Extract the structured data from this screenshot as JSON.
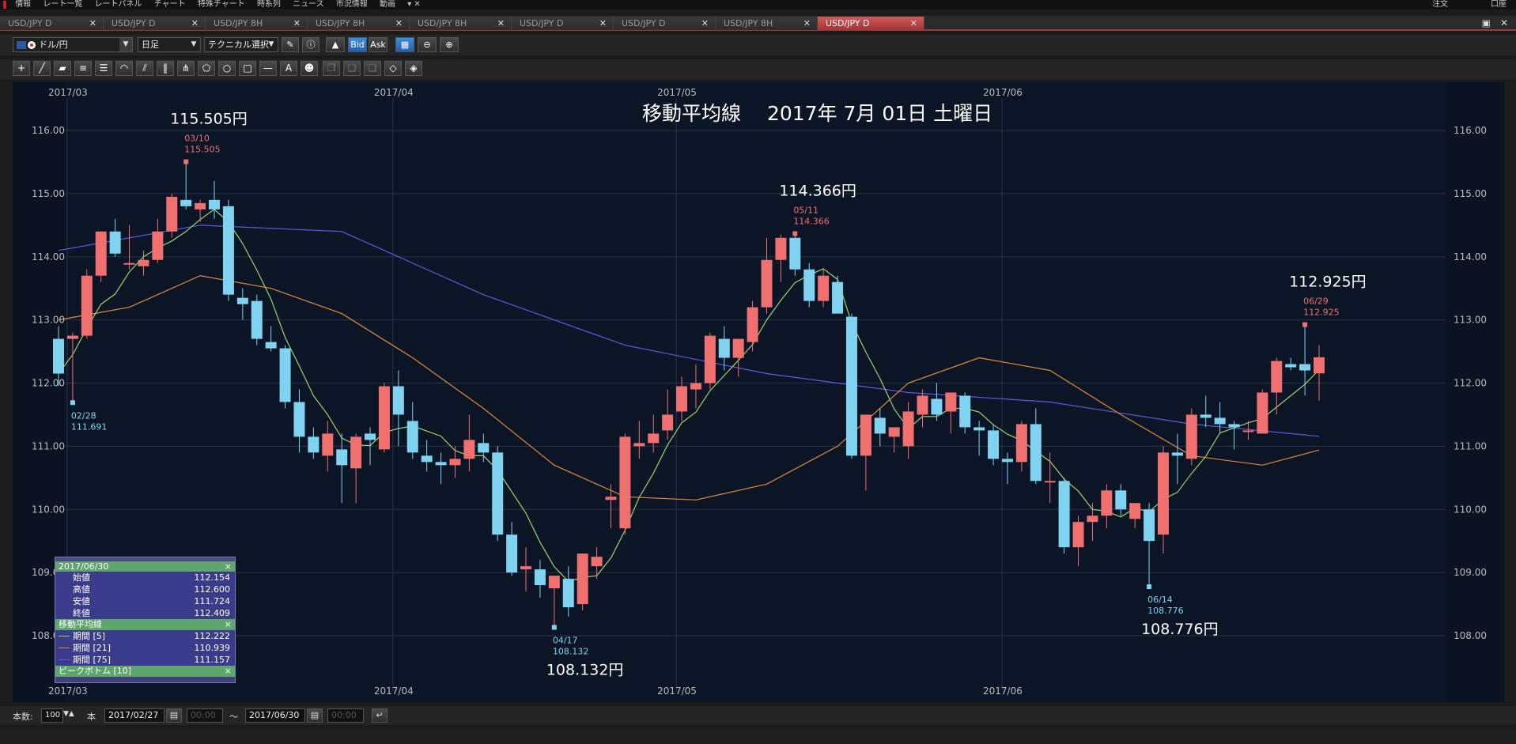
{
  "menubar": {
    "items": [
      "情報",
      "レート一覧",
      "レートパネル",
      "チャート",
      "特殊チャート",
      "時系列",
      "ニュース",
      "市況情報",
      "動画"
    ],
    "right_items": [
      "注文",
      "口座"
    ]
  },
  "tabs": [
    {
      "label": "USD/JPY D",
      "active": false
    },
    {
      "label": "USD/JPY D",
      "active": false
    },
    {
      "label": "USD/JPY 8H",
      "active": false
    },
    {
      "label": "USD/JPY 8H",
      "active": false
    },
    {
      "label": "USD/JPY 8H",
      "active": false
    },
    {
      "label": "USD/JPY D",
      "active": false
    },
    {
      "label": "USD/JPY D",
      "active": false
    },
    {
      "label": "USD/JPY 8H",
      "active": false
    },
    {
      "label": "USD/JPY D",
      "active": true
    }
  ],
  "toolbar": {
    "symbol": "ドル/円",
    "timeframe": "日足",
    "technical": "テクニカル選択",
    "bid_label": "Bid",
    "ask_label": "Ask"
  },
  "status": {
    "count_label": "本数:",
    "count_value": "100",
    "count_unit": "本",
    "from_date": "2017/02/27",
    "from_time": "00:00",
    "tilde": "〜",
    "to_date": "2017/06/30",
    "to_time": "00:00"
  },
  "data_window": {
    "date": "2017/06/30",
    "rows": [
      {
        "label": "始値",
        "value": "112.154"
      },
      {
        "label": "高値",
        "value": "112.600"
      },
      {
        "label": "安値",
        "value": "111.724"
      },
      {
        "label": "終値",
        "value": "112.409"
      }
    ],
    "ma_section": "移動平均線",
    "ma_rows": [
      {
        "label": "期間 [5]",
        "value": "112.222",
        "color": "#9bd66b"
      },
      {
        "label": "期間 [21]",
        "value": "110.939",
        "color": "#e08a3a"
      },
      {
        "label": "期間 [75]",
        "value": "111.157",
        "color": "#5b5be0"
      }
    ],
    "peak_section": "ピークボトム [10]"
  },
  "chart_data": {
    "type": "candlestick",
    "title": "移動平均線　 2017年 7月 01日 土曜日",
    "ylim": [
      107.0,
      117.0
    ],
    "yticks": [
      "108.00",
      "109.00",
      "110.00",
      "111.00",
      "112.00",
      "113.00",
      "114.00",
      "115.00",
      "116.00"
    ],
    "month_labels": [
      {
        "label": "2017/03",
        "index": 1
      },
      {
        "label": "2017/04",
        "index": 24
      },
      {
        "label": "2017/05",
        "index": 44
      },
      {
        "label": "2017/06",
        "index": 67
      }
    ],
    "candles": [
      [
        112.7,
        112.9,
        111.95,
        112.15
      ],
      [
        112.7,
        112.8,
        111.69,
        112.75
      ],
      [
        112.75,
        113.8,
        112.7,
        113.7
      ],
      [
        113.7,
        114.4,
        113.6,
        114.4
      ],
      [
        114.4,
        114.6,
        114.0,
        114.05
      ],
      [
        113.9,
        114.5,
        113.8,
        113.9
      ],
      [
        113.85,
        114.1,
        113.7,
        113.95
      ],
      [
        113.95,
        114.6,
        113.9,
        114.4
      ],
      [
        114.4,
        115.0,
        114.3,
        114.95
      ],
      [
        114.9,
        115.505,
        114.75,
        114.8
      ],
      [
        114.75,
        114.9,
        114.55,
        114.85
      ],
      [
        114.9,
        115.2,
        114.6,
        114.75
      ],
      [
        114.8,
        114.9,
        113.3,
        113.4
      ],
      [
        113.35,
        113.5,
        113.0,
        113.25
      ],
      [
        113.3,
        113.4,
        112.6,
        112.7
      ],
      [
        112.65,
        112.9,
        112.5,
        112.55
      ],
      [
        112.55,
        112.6,
        111.6,
        111.7
      ],
      [
        111.7,
        111.9,
        110.9,
        111.15
      ],
      [
        111.15,
        111.3,
        110.8,
        110.9
      ],
      [
        110.85,
        111.4,
        110.6,
        111.2
      ],
      [
        110.95,
        111.2,
        110.1,
        110.7
      ],
      [
        110.65,
        111.2,
        110.1,
        111.15
      ],
      [
        111.2,
        111.3,
        110.7,
        111.1
      ],
      [
        110.95,
        112.0,
        110.9,
        111.95
      ],
      [
        111.95,
        112.2,
        111.0,
        111.5
      ],
      [
        111.4,
        111.7,
        110.8,
        110.9
      ],
      [
        110.85,
        111.1,
        110.6,
        110.75
      ],
      [
        110.75,
        110.9,
        110.4,
        110.7
      ],
      [
        110.7,
        111.0,
        110.5,
        110.8
      ],
      [
        110.8,
        111.5,
        110.6,
        111.1
      ],
      [
        111.05,
        111.2,
        110.75,
        110.9
      ],
      [
        110.9,
        111.0,
        109.5,
        109.6
      ],
      [
        109.6,
        109.8,
        108.95,
        109.0
      ],
      [
        109.05,
        109.4,
        108.7,
        109.1
      ],
      [
        109.05,
        109.2,
        108.6,
        108.8
      ],
      [
        108.75,
        108.95,
        108.132,
        108.95
      ],
      [
        108.9,
        109.1,
        108.3,
        108.45
      ],
      [
        108.5,
        109.3,
        108.4,
        109.3
      ],
      [
        109.1,
        109.4,
        108.9,
        109.25
      ],
      [
        110.15,
        110.4,
        109.7,
        110.2
      ],
      [
        109.7,
        111.2,
        109.6,
        111.15
      ],
      [
        111.0,
        111.4,
        110.8,
        111.05
      ],
      [
        111.05,
        111.5,
        110.9,
        111.2
      ],
      [
        111.25,
        111.9,
        111.1,
        111.5
      ],
      [
        111.55,
        112.1,
        111.4,
        111.95
      ],
      [
        111.9,
        112.3,
        111.6,
        112.0
      ],
      [
        112.0,
        112.8,
        111.9,
        112.75
      ],
      [
        112.7,
        112.9,
        112.2,
        112.4
      ],
      [
        112.4,
        112.7,
        112.1,
        112.7
      ],
      [
        112.65,
        113.3,
        112.5,
        113.2
      ],
      [
        113.2,
        114.3,
        113.1,
        113.95
      ],
      [
        113.95,
        114.35,
        113.6,
        114.3
      ],
      [
        114.3,
        114.366,
        113.7,
        113.8
      ],
      [
        113.8,
        113.9,
        113.2,
        113.3
      ],
      [
        113.3,
        113.8,
        113.2,
        113.7
      ],
      [
        113.6,
        113.7,
        113.1,
        113.1
      ],
      [
        113.05,
        113.1,
        110.8,
        110.85
      ],
      [
        110.85,
        111.5,
        110.3,
        111.5
      ],
      [
        111.45,
        111.6,
        111.0,
        111.2
      ],
      [
        111.15,
        111.3,
        110.9,
        111.3
      ],
      [
        111.0,
        111.7,
        110.8,
        111.55
      ],
      [
        111.5,
        111.9,
        111.3,
        111.8
      ],
      [
        111.75,
        112.0,
        111.4,
        111.5
      ],
      [
        111.55,
        111.85,
        111.2,
        111.85
      ],
      [
        111.8,
        111.85,
        111.2,
        111.3
      ],
      [
        111.3,
        111.4,
        110.85,
        111.25
      ],
      [
        111.25,
        111.35,
        110.7,
        110.8
      ],
      [
        110.8,
        110.9,
        110.4,
        110.75
      ],
      [
        110.75,
        111.4,
        110.6,
        111.35
      ],
      [
        111.35,
        111.6,
        110.4,
        110.45
      ],
      [
        110.45,
        110.9,
        110.1,
        110.45
      ],
      [
        110.45,
        110.5,
        109.3,
        109.4
      ],
      [
        109.4,
        109.9,
        109.1,
        109.8
      ],
      [
        109.8,
        110.1,
        109.5,
        109.9
      ],
      [
        109.9,
        110.4,
        109.7,
        110.3
      ],
      [
        110.3,
        110.4,
        109.9,
        110.0
      ],
      [
        109.85,
        110.1,
        109.7,
        110.1
      ],
      [
        110.0,
        110.1,
        108.776,
        109.5
      ],
      [
        109.6,
        111.0,
        109.3,
        110.9
      ],
      [
        110.9,
        111.2,
        110.4,
        110.85
      ],
      [
        110.8,
        111.6,
        110.7,
        111.5
      ],
      [
        111.5,
        111.8,
        111.3,
        111.45
      ],
      [
        111.45,
        111.7,
        111.2,
        111.35
      ],
      [
        111.35,
        111.4,
        110.95,
        111.3
      ],
      [
        111.25,
        111.4,
        111.1,
        111.25
      ],
      [
        111.2,
        111.9,
        111.2,
        111.85
      ],
      [
        111.85,
        112.4,
        111.5,
        112.35
      ],
      [
        112.3,
        112.4,
        112.2,
        112.25
      ],
      [
        112.3,
        112.925,
        111.8,
        112.2
      ],
      [
        112.154,
        112.6,
        111.724,
        112.409
      ]
    ],
    "series": [
      {
        "name": "期間 [5]",
        "color": "#9bd66b"
      },
      {
        "name": "期間 [21]",
        "color": "#e08a3a"
      },
      {
        "name": "期間 [75]",
        "color": "#5b5be0"
      }
    ],
    "ma75_points": [
      [
        0,
        114.1
      ],
      [
        10,
        114.5
      ],
      [
        20,
        114.4
      ],
      [
        30,
        113.4
      ],
      [
        40,
        112.6
      ],
      [
        50,
        112.15
      ],
      [
        60,
        111.85
      ],
      [
        70,
        111.7
      ],
      [
        80,
        111.35
      ],
      [
        89,
        111.157
      ]
    ],
    "ma21_points": [
      [
        0,
        113.0
      ],
      [
        5,
        113.2
      ],
      [
        10,
        113.7
      ],
      [
        15,
        113.5
      ],
      [
        20,
        113.1
      ],
      [
        25,
        112.4
      ],
      [
        30,
        111.6
      ],
      [
        35,
        110.7
      ],
      [
        40,
        110.2
      ],
      [
        45,
        110.15
      ],
      [
        50,
        110.4
      ],
      [
        55,
        111.0
      ],
      [
        60,
        112.0
      ],
      [
        65,
        112.4
      ],
      [
        70,
        112.2
      ],
      [
        75,
        111.5
      ],
      [
        80,
        110.85
      ],
      [
        85,
        110.7
      ],
      [
        89,
        110.939
      ]
    ],
    "peaks": [
      {
        "index": 9,
        "date": "03/10",
        "value": "115.505",
        "kind": "high",
        "big": "115.505円"
      },
      {
        "index": 1,
        "date": "02/28",
        "value": "111.691",
        "kind": "low",
        "big": ""
      },
      {
        "index": 35,
        "date": "04/17",
        "value": "108.132",
        "kind": "low",
        "big": "108.132円"
      },
      {
        "index": 52,
        "date": "05/11",
        "value": "114.366",
        "kind": "high",
        "big": "114.366円"
      },
      {
        "index": 77,
        "date": "06/14",
        "value": "108.776",
        "kind": "low",
        "big": "108.776円"
      },
      {
        "index": 88,
        "date": "06/29",
        "value": "112.925",
        "kind": "high",
        "big": "112.925円"
      }
    ]
  }
}
